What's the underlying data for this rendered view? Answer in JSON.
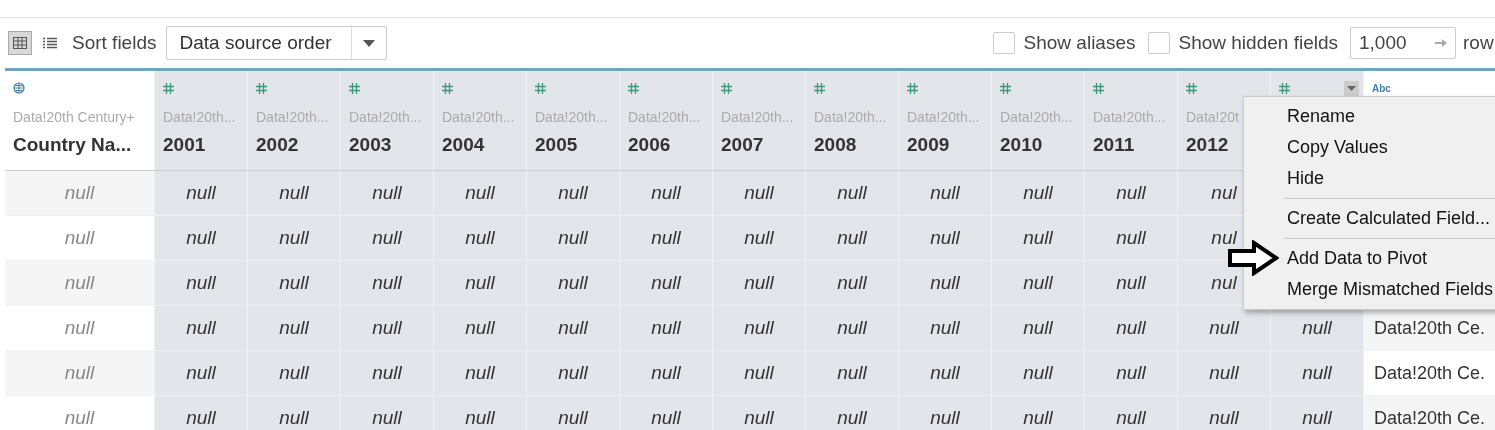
{
  "toolbar": {
    "view_modes": [
      {
        "kind": "grid",
        "selected": true
      },
      {
        "kind": "list",
        "selected": false
      }
    ],
    "sort_label": "Sort fields",
    "sort_value": "Data source order",
    "checkboxes": [
      {
        "label": "Show aliases",
        "checked": false
      },
      {
        "label": "Show hidden fields",
        "checked": false
      }
    ],
    "rows_value": "1,000",
    "rows_label": "row"
  },
  "columns": [
    {
      "kind": "geo",
      "source": "Data!20th Century+",
      "name": "Country Na..."
    },
    {
      "kind": "number",
      "source": "Data!20th...",
      "name": "2001"
    },
    {
      "kind": "number",
      "source": "Data!20th...",
      "name": "2002"
    },
    {
      "kind": "number",
      "source": "Data!20th...",
      "name": "2003"
    },
    {
      "kind": "number",
      "source": "Data!20th...",
      "name": "2004"
    },
    {
      "kind": "number",
      "source": "Data!20th...",
      "name": "2005"
    },
    {
      "kind": "number",
      "source": "Data!20th...",
      "name": "2006"
    },
    {
      "kind": "number",
      "source": "Data!20th...",
      "name": "2007"
    },
    {
      "kind": "number",
      "source": "Data!20th...",
      "name": "2008"
    },
    {
      "kind": "number",
      "source": "Data!20th...",
      "name": "2009"
    },
    {
      "kind": "number",
      "source": "Data!20th...",
      "name": "2010"
    },
    {
      "kind": "number",
      "source": "Data!20th...",
      "name": "2011"
    },
    {
      "kind": "number",
      "source": "Data!20t",
      "name": "2012"
    },
    {
      "kind": "number",
      "menu_open": true
    },
    {
      "kind": "string",
      "type_label": "Abc"
    }
  ],
  "rows": [
    {
      "cells": [
        "null",
        "null",
        "null",
        "null",
        "null",
        "null",
        "null",
        "null",
        "null",
        "null",
        "null",
        "null",
        "nul"
      ]
    },
    {
      "cells": [
        "null",
        "null",
        "null",
        "null",
        "null",
        "null",
        "null",
        "null",
        "null",
        "null",
        "null",
        "null",
        "nul"
      ]
    },
    {
      "cells": [
        "null",
        "null",
        "null",
        "null",
        "null",
        "null",
        "null",
        "null",
        "null",
        "null",
        "null",
        "null",
        "nul"
      ]
    },
    {
      "cells": [
        "null",
        "null",
        "null",
        "null",
        "null",
        "null",
        "null",
        "null",
        "null",
        "null",
        "null",
        "null",
        "null",
        "null",
        "Data!20th Ce."
      ]
    },
    {
      "cells": [
        "null",
        "null",
        "null",
        "null",
        "null",
        "null",
        "null",
        "null",
        "null",
        "null",
        "null",
        "null",
        "null",
        "null",
        "Data!20th Ce."
      ]
    },
    {
      "cells": [
        "null",
        "null",
        "null",
        "null",
        "null",
        "null",
        "null",
        "null",
        "null",
        "null",
        "null",
        "null",
        "null",
        "null",
        "Data!20th Ce."
      ]
    }
  ],
  "context_menu": {
    "items": [
      {
        "label": "Rename",
        "separator_before": false
      },
      {
        "label": "Copy Values",
        "separator_before": false
      },
      {
        "label": "Hide",
        "separator_before": false
      },
      {
        "label": "Create Calculated Field...",
        "separator_before": true
      },
      {
        "label": "Add Data to Pivot",
        "separator_before": true,
        "pointed": true
      },
      {
        "label": "Merge Mismatched Fields",
        "separator_before": false
      }
    ]
  }
}
